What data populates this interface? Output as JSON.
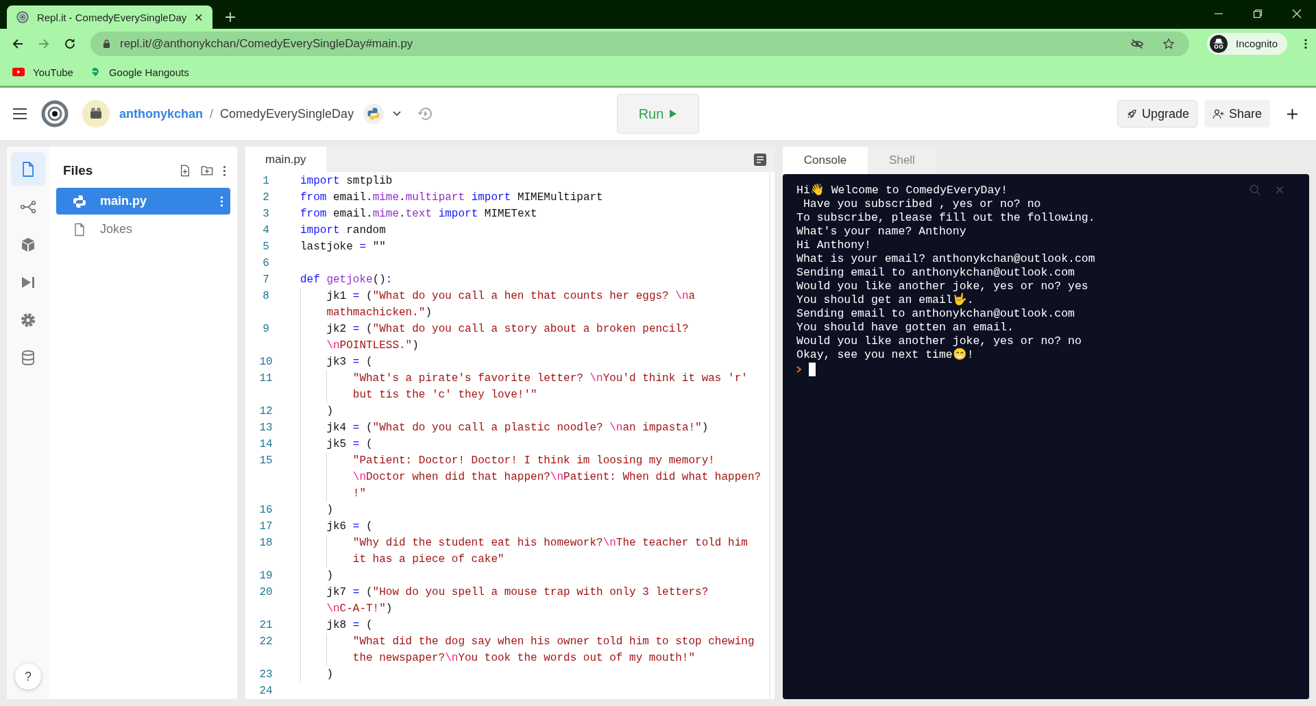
{
  "browser": {
    "tab": {
      "title": "Repl.it - ComedyEverySingleDay"
    },
    "url": "repl.it/@anthonykchan/ComedyEverySingleDay#main.py",
    "profile": "Incognito",
    "bookmarks": [
      {
        "label": "YouTube",
        "kind": "youtube"
      },
      {
        "label": "Google Hangouts",
        "kind": "hangouts"
      }
    ]
  },
  "header": {
    "owner": "anthonykchan",
    "separator": "/",
    "repl": "ComedyEverySingleDay",
    "run": "Run",
    "upgrade": "Upgrade",
    "share": "Share"
  },
  "sidebar": {
    "items": [
      {
        "kind": "files",
        "selected": true
      },
      {
        "kind": "share",
        "selected": false
      },
      {
        "kind": "packages",
        "selected": false
      },
      {
        "kind": "debugger",
        "selected": false
      },
      {
        "kind": "settings",
        "selected": false
      },
      {
        "kind": "database",
        "selected": false
      }
    ],
    "help": "?"
  },
  "files": {
    "title": "Files",
    "items": [
      {
        "name": "main.py",
        "kind": "python",
        "selected": true
      },
      {
        "name": "Jokes",
        "kind": "file",
        "selected": false
      }
    ]
  },
  "editor": {
    "tabs": [
      {
        "label": "main.py",
        "selected": true
      }
    ],
    "lines": [
      {
        "number": "1",
        "rows": [
          {
            "segments": [
              {
                "kind": "keyword",
                "text": "import"
              },
              {
                "kind": "plain",
                "text": " smtplib"
              }
            ]
          }
        ]
      },
      {
        "number": "2",
        "rows": [
          {
            "segments": [
              {
                "kind": "keyword",
                "text": "from"
              },
              {
                "kind": "plain",
                "text": " email."
              },
              {
                "kind": "name",
                "text": "mime"
              },
              {
                "kind": "plain",
                "text": "."
              },
              {
                "kind": "name",
                "text": "multipart"
              },
              {
                "kind": "keyword",
                "text": " import"
              },
              {
                "kind": "plain",
                "text": " MIMEMultipart"
              }
            ]
          }
        ]
      },
      {
        "number": "3",
        "rows": [
          {
            "segments": [
              {
                "kind": "keyword",
                "text": "from"
              },
              {
                "kind": "plain",
                "text": " email."
              },
              {
                "kind": "name",
                "text": "mime"
              },
              {
                "kind": "plain",
                "text": "."
              },
              {
                "kind": "name",
                "text": "text"
              },
              {
                "kind": "keyword",
                "text": " import"
              },
              {
                "kind": "plain",
                "text": " MIMEText"
              }
            ]
          }
        ]
      },
      {
        "number": "4",
        "rows": [
          {
            "segments": [
              {
                "kind": "keyword",
                "text": "import"
              },
              {
                "kind": "plain",
                "text": " random"
              }
            ]
          }
        ]
      },
      {
        "number": "5",
        "rows": [
          {
            "segments": [
              {
                "kind": "plain",
                "text": "lastjoke "
              },
              {
                "kind": "operator",
                "text": "="
              },
              {
                "kind": "plain",
                "text": " \"\""
              }
            ]
          }
        ]
      },
      {
        "number": "6"
      },
      {
        "number": "7",
        "rows": [
          {
            "segments": [
              {
                "kind": "keyword",
                "text": "def "
              },
              {
                "kind": "name",
                "text": "getjoke"
              },
              {
                "kind": "plain",
                "text": "()"
              },
              {
                "kind": "operator",
                "text": ":"
              }
            ]
          }
        ]
      },
      {
        "number": "8",
        "rows": [
          {
            "segments": [
              {
                "kind": "plain",
                "text": "    jk1 "
              },
              {
                "kind": "operator",
                "text": "="
              },
              {
                "kind": "plain",
                "text": " ("
              },
              {
                "kind": "string",
                "text": "\"What do you call a hen that counts her eggs? "
              },
              {
                "kind": "escape",
                "text": "\\n"
              },
              {
                "kind": "string",
                "text": "a"
              }
            ]
          },
          {
            "segments": [
              {
                "kind": "string",
                "text": "mathmachicken.\""
              },
              {
                "kind": "plain",
                "text": ")"
              }
            ]
          }
        ]
      },
      {
        "number": "9",
        "rows": [
          {
            "segments": [
              {
                "kind": "plain",
                "text": "    jk2 "
              },
              {
                "kind": "operator",
                "text": "="
              },
              {
                "kind": "plain",
                "text": " ("
              },
              {
                "kind": "string",
                "text": "\"What do you call a story about a broken pencil?"
              }
            ]
          },
          {
            "segments": [
              {
                "kind": "escape",
                "text": "\\n"
              },
              {
                "kind": "string",
                "text": "POINTLESS.\""
              },
              {
                "kind": "plain",
                "text": ")"
              }
            ]
          }
        ]
      },
      {
        "number": "10",
        "rows": [
          {
            "segments": [
              {
                "kind": "plain",
                "text": "    jk3 "
              },
              {
                "kind": "operator",
                "text": "="
              },
              {
                "kind": "plain",
                "text": " ("
              }
            ]
          }
        ]
      },
      {
        "number": "11",
        "rows": [
          {
            "segments": [
              {
                "kind": "string",
                "text": "        \"What's a pirate's favorite letter? "
              },
              {
                "kind": "escape",
                "text": "\\n"
              },
              {
                "kind": "string",
                "text": "You'd think it was 'r'"
              }
            ]
          },
          {
            "segments": [
              {
                "kind": "string",
                "text": "but tis the 'c' they love!'\""
              }
            ]
          }
        ]
      },
      {
        "number": "12",
        "rows": [
          {
            "segments": [
              {
                "kind": "plain",
                "text": "    )"
              }
            ]
          }
        ]
      },
      {
        "number": "13",
        "rows": [
          {
            "segments": [
              {
                "kind": "plain",
                "text": "    jk4 "
              },
              {
                "kind": "operator",
                "text": "="
              },
              {
                "kind": "plain",
                "text": " ("
              },
              {
                "kind": "string",
                "text": "\"What do you call a plastic noodle? "
              },
              {
                "kind": "escape",
                "text": "\\n"
              },
              {
                "kind": "string",
                "text": "an impasta!\""
              },
              {
                "kind": "plain",
                "text": ")"
              }
            ]
          }
        ]
      },
      {
        "number": "14",
        "rows": [
          {
            "segments": [
              {
                "kind": "plain",
                "text": "    jk5 "
              },
              {
                "kind": "operator",
                "text": "="
              },
              {
                "kind": "plain",
                "text": " ("
              }
            ]
          }
        ]
      },
      {
        "number": "15",
        "rows": [
          {
            "segments": [
              {
                "kind": "string",
                "text": "        \"Patient: Doctor! Doctor! I think im loosing my memory!"
              }
            ]
          },
          {
            "segments": [
              {
                "kind": "escape",
                "text": "\\n"
              },
              {
                "kind": "string",
                "text": "Doctor when did that happen?"
              },
              {
                "kind": "escape",
                "text": "\\n"
              },
              {
                "kind": "string",
                "text": "Patient: When did what happen?"
              }
            ]
          },
          {
            "segments": [
              {
                "kind": "string",
                "text": "!\""
              }
            ]
          }
        ]
      },
      {
        "number": "16",
        "rows": [
          {
            "segments": [
              {
                "kind": "plain",
                "text": "    )"
              }
            ]
          }
        ]
      },
      {
        "number": "17",
        "rows": [
          {
            "segments": [
              {
                "kind": "plain",
                "text": "    jk6 "
              },
              {
                "kind": "operator",
                "text": "="
              },
              {
                "kind": "plain",
                "text": " ("
              }
            ]
          }
        ]
      },
      {
        "number": "18",
        "rows": [
          {
            "segments": [
              {
                "kind": "string",
                "text": "        \"Why did the student eat his homework?"
              },
              {
                "kind": "escape",
                "text": "\\n"
              },
              {
                "kind": "string",
                "text": "The teacher told him"
              }
            ]
          },
          {
            "segments": [
              {
                "kind": "string",
                "text": "it has a piece of cake\""
              }
            ]
          }
        ]
      },
      {
        "number": "19",
        "rows": [
          {
            "segments": [
              {
                "kind": "plain",
                "text": "    )"
              }
            ]
          }
        ]
      },
      {
        "number": "20",
        "rows": [
          {
            "segments": [
              {
                "kind": "plain",
                "text": "    jk7 "
              },
              {
                "kind": "operator",
                "text": "="
              },
              {
                "kind": "plain",
                "text": " ("
              },
              {
                "kind": "string",
                "text": "\"How do you spell a mouse trap with only 3 letters?"
              }
            ]
          },
          {
            "segments": [
              {
                "kind": "escape",
                "text": "\\n"
              },
              {
                "kind": "string",
                "text": "C-A-T!\""
              },
              {
                "kind": "plain",
                "text": ")"
              }
            ]
          }
        ]
      },
      {
        "number": "21",
        "rows": [
          {
            "segments": [
              {
                "kind": "plain",
                "text": "    jk8 "
              },
              {
                "kind": "operator",
                "text": "="
              },
              {
                "kind": "plain",
                "text": " ("
              }
            ]
          }
        ]
      },
      {
        "number": "22",
        "rows": [
          {
            "segments": [
              {
                "kind": "string",
                "text": "        \"What did the dog say when his owner told him to stop chewing"
              }
            ]
          },
          {
            "segments": [
              {
                "kind": "string",
                "text": "the newspaper?"
              },
              {
                "kind": "escape",
                "text": "\\n"
              },
              {
                "kind": "string",
                "text": "You took the words out of my mouth!\""
              }
            ]
          }
        ]
      },
      {
        "number": "23",
        "rows": [
          {
            "segments": [
              {
                "kind": "plain",
                "text": "    )"
              }
            ]
          }
        ]
      },
      {
        "number": "24"
      }
    ]
  },
  "console": {
    "tabs": [
      {
        "label": "Console",
        "selected": true
      },
      {
        "label": "Shell",
        "selected": false
      }
    ],
    "output": [
      "Hi👋 Welcome to ComedyEveryDay!",
      " Have you subscribed , yes or no? no",
      "To subscribe, please fill out the following.",
      "What's your name? Anthony",
      "Hi Anthony!",
      "What is your email? anthonykchan@outlook.com",
      "Sending email to anthonykchan@outlook.com",
      "Would you like another joke, yes or no? yes",
      "You should get an email🤟.",
      "Sending email to anthonykchan@outlook.com",
      "You should have gotten an email.",
      "Would you like another joke, yes or no? no",
      "Okay, see you next time😁!"
    ]
  }
}
